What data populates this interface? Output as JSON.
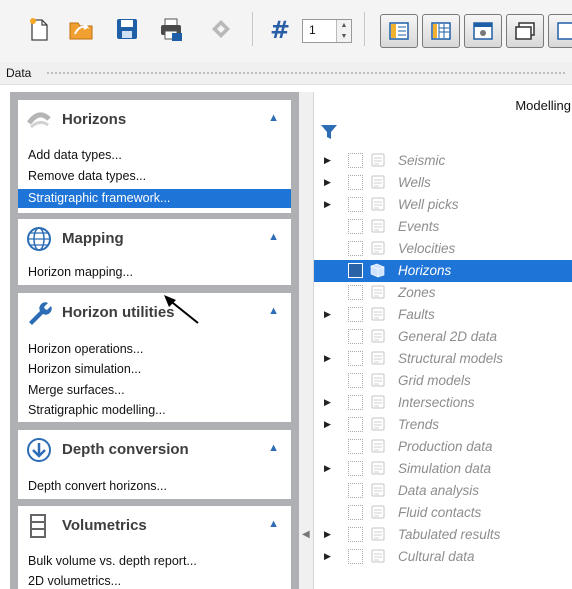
{
  "toolbar": {
    "page_number": "1",
    "icons": [
      "new-file-icon",
      "open-folder-icon",
      "save-icon",
      "print-icon",
      "diamond-tool-icon",
      "hash-icon",
      "view-tree-icon",
      "view-columns-icon",
      "view-window-icon",
      "view-stack-icon",
      "view-extra-icon"
    ]
  },
  "data_bar": {
    "label": "Data"
  },
  "sections": [
    {
      "title": "Horizons",
      "icon": "horizons-icon",
      "items": [
        "Add data types...",
        "Remove data types...",
        "Stratigraphic framework..."
      ],
      "selected_index": 2
    },
    {
      "title": "Mapping",
      "icon": "globe-icon",
      "items": [
        "Horizon mapping..."
      ]
    },
    {
      "title": "Horizon utilities",
      "icon": "wrench-icon",
      "items": [
        "Horizon operations...",
        "Horizon simulation...",
        "Merge surfaces...",
        "Stratigraphic modelling..."
      ]
    },
    {
      "title": "Depth conversion",
      "icon": "down-arrow-circle-icon",
      "items": [
        "Depth convert horizons..."
      ]
    },
    {
      "title": "Volumetrics",
      "icon": "volumetrics-icon",
      "items": [
        "Bulk volume vs. depth report...",
        "2D volumetrics..."
      ]
    }
  ],
  "right_panel": {
    "header": "Modelling",
    "tree": [
      {
        "label": "Seismic",
        "expandable": true
      },
      {
        "label": "Wells",
        "expandable": true
      },
      {
        "label": "Well picks",
        "expandable": true
      },
      {
        "label": "Events",
        "expandable": false
      },
      {
        "label": "Velocities",
        "expandable": false
      },
      {
        "label": "Horizons",
        "expandable": false,
        "selected": true
      },
      {
        "label": "Zones",
        "expandable": false
      },
      {
        "label": "Faults",
        "expandable": true
      },
      {
        "label": "General 2D data",
        "expandable": false
      },
      {
        "label": "Structural models",
        "expandable": true
      },
      {
        "label": "Grid models",
        "expandable": false
      },
      {
        "label": "Intersections",
        "expandable": true
      },
      {
        "label": "Trends",
        "expandable": true
      },
      {
        "label": "Production data",
        "expandable": false
      },
      {
        "label": "Simulation data",
        "expandable": true
      },
      {
        "label": "Data analysis",
        "expandable": false
      },
      {
        "label": "Fluid contacts",
        "expandable": false
      },
      {
        "label": "Tabulated results",
        "expandable": true
      },
      {
        "label": "Cultural data",
        "expandable": true
      }
    ]
  },
  "colors": {
    "selection": "#1f74d8",
    "accent": "#2c6db5",
    "panel_frame": "#aeb0b3"
  }
}
